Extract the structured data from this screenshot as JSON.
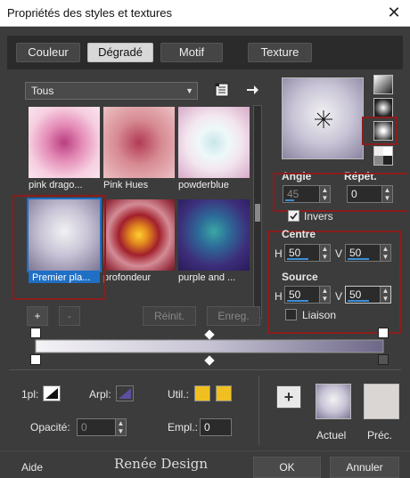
{
  "window": {
    "title": "Propriétés des styles et textures",
    "close_glyph": "✕"
  },
  "tabs": [
    {
      "label": "Couleur"
    },
    {
      "label": "Dégradé"
    },
    {
      "label": "Motif"
    },
    {
      "label": "Texture"
    }
  ],
  "category": {
    "selected": "Tous"
  },
  "presets": [
    {
      "label": "pink dragon...",
      "display": "pink drago..."
    },
    {
      "label": "Pink Hues"
    },
    {
      "label": "powderblue"
    },
    {
      "label": "Premier pla..."
    },
    {
      "label": "profondeur"
    },
    {
      "label": "purple and ..."
    }
  ],
  "list_buttons": {
    "add": "+",
    "remove": "-",
    "reset": "Réinit.",
    "save": "Enreg."
  },
  "gradient": {
    "angle_label": "Angle",
    "angle_value": "45",
    "repeat_label": "Répét.",
    "repeat_value": "0",
    "invert_label": "Invers",
    "invert_checked": true,
    "center_label": "Centre",
    "center_h_label": "H",
    "center_h": "50",
    "center_v_label": "V",
    "center_v": "50",
    "source_label": "Source",
    "source_h_label": "H",
    "source_h": "50",
    "source_v_label": "V",
    "source_v": "50",
    "link_label": "Liaison",
    "link_checked": false
  },
  "lower": {
    "pl_label": "1pl:",
    "arpl_label": "Arpl:",
    "util_label": "Util.:",
    "opacity_label": "Opacité:",
    "opacity_value": "0",
    "empl_label": "Empl.:",
    "empl_value": "0"
  },
  "swatches": {
    "current_label": "Actuel",
    "previous_label": "Préc.",
    "add_glyph": "+"
  },
  "footer": {
    "help": "Aide",
    "ok": "OK",
    "cancel": "Annuler",
    "watermark": "Renée Design"
  },
  "colors": {
    "accent_red": "#8b1d1d",
    "selection_blue": "#1f6fc4",
    "yellow": "#f0c020"
  }
}
